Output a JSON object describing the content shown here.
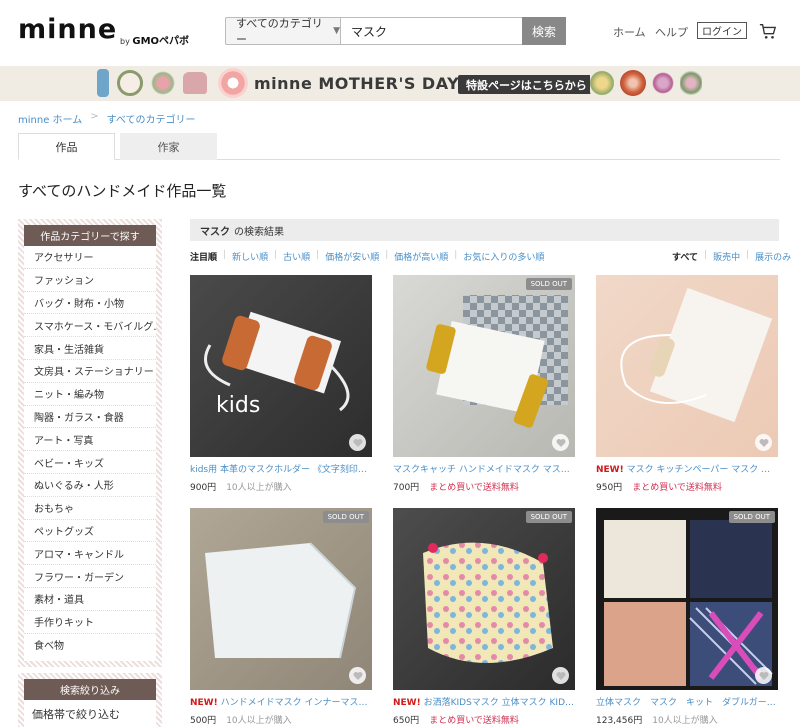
{
  "header": {
    "logo": "minne",
    "logo_sub_prefix": "by",
    "logo_sub_brand": "GMOペパボ",
    "category_select": "すべてのカテゴリー",
    "search_value": "マスク",
    "search_button": "検索",
    "links": [
      "ホーム",
      "ヘルプ"
    ],
    "login": "ログイン"
  },
  "banner": {
    "title": "minne MOTHER'S DAY",
    "special": "特設ページはこちらから"
  },
  "breadcrumb": [
    "minne ホーム",
    "すべてのカテゴリー"
  ],
  "tabs": [
    "作品",
    "作家"
  ],
  "page_title": "すべてのハンドメイド作品一覧",
  "sidebar": {
    "heading": "作品カテゴリーで探す",
    "items": [
      "アクセサリー",
      "ファッション",
      "バッグ・財布・小物",
      "スマホケース・モバイルグ…",
      "家具・生活雑貨",
      "文房具・ステーショナリー",
      "ニット・編み物",
      "陶器・ガラス・食器",
      "アート・写真",
      "ベビー・キッズ",
      "ぬいぐるみ・人形",
      "おもちゃ",
      "ペットグッズ",
      "アロマ・キャンドル",
      "フラワー・ガーデン",
      "素材・道具",
      "手作りキット",
      "食べ物"
    ],
    "filter_heading": "検索絞り込み",
    "filter_item": "価格帯で絞り込む"
  },
  "results": {
    "keyword": "マスク",
    "suffix": "の検索結果",
    "sort": [
      "注目順",
      "新しい順",
      "古い順",
      "価格が安い順",
      "価格が高い順",
      "お気に入りの多い順"
    ],
    "filter": [
      "すべて",
      "販売中",
      "展示のみ"
    ]
  },
  "products": [
    {
      "title": "kids用 本革のマスクホルダー 《文字刻印オ…",
      "new": "",
      "price": "900円",
      "note": "10人以上が購入",
      "note_type": "count",
      "sold_out": "",
      "image_text": "kids"
    },
    {
      "title": "マスクキャッチ ハンドメイドマスク マス…",
      "new": "",
      "price": "700円",
      "note": "まとめ買いで送料無料",
      "note_type": "promo",
      "sold_out": "SOLD OUT",
      "image_text": ""
    },
    {
      "title": "マスク キッチンペーパー マスク サ…",
      "new": "NEW!",
      "price": "950円",
      "note": "まとめ買いで送料無料",
      "note_type": "promo",
      "sold_out": "",
      "image_text": ""
    },
    {
      "title": "ハンドメイドマスク インナーマスク 白",
      "new": "NEW!",
      "price": "500円",
      "note": "10人以上が購入",
      "note_type": "count",
      "sold_out": "SOLD OUT",
      "image_text": ""
    },
    {
      "title": "お洒落KIDSマスク 立体マスク KIDS…",
      "new": "NEW!",
      "price": "650円",
      "note": "まとめ買いで送料無料",
      "note_type": "promo",
      "sold_out": "SOLD OUT",
      "image_text": ""
    },
    {
      "title": "立体マスク　マスク　キット　ダブルガー…",
      "new": "",
      "price": "123,456円",
      "note": "10人以上が購入",
      "note_type": "count",
      "sold_out": "SOLD OUT",
      "image_text": ""
    }
  ],
  "colors": {
    "link": "#4a8fc8",
    "accent_dark": "#6f5b55",
    "new": "#d01a1a",
    "promo": "#d03050",
    "banner_bg": "#f1ece3"
  }
}
